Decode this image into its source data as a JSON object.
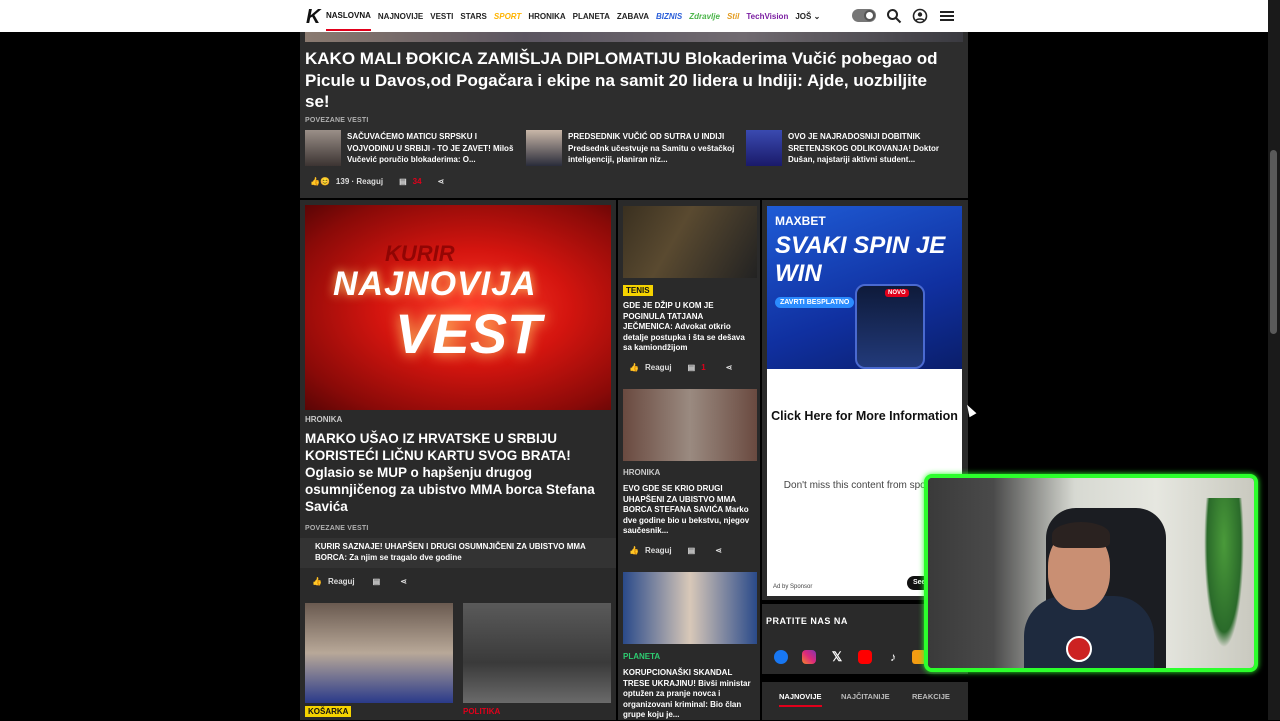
{
  "nav": {
    "logo": "K",
    "items": [
      "NASLOVNA",
      "NAJNOVIJE",
      "VESTI",
      "STARS",
      "SPORT",
      "HRONIKA",
      "PLANETA",
      "ZABAVA",
      "BIZNIS",
      "Zdravlje",
      "Stil",
      "TechVision",
      "JOŠ"
    ],
    "active": "NASLOVNA"
  },
  "top_story": {
    "headline": "KAKO MALI ĐOKICA ZAMIŠLJA DIPLOMATIJU Blokaderima Vučić pobegao od Picule u Davos,od Pogačara i ekipe na samit 20 lidera u Indiji: Ajde, uozbiljite se!",
    "related_label": "POVEZANE VESTI",
    "related": [
      {
        "text": "SAČUVAĆEMO MATICU SRPSKU I VOJVODINU U SRBIJI - TO JE ZAVET! Miloš Vučević poručio blokaderima: O..."
      },
      {
        "text": "PREDSEDNIK VUČIĆ OD SUTRA U INDIJI Predsednk učestvuje na Samitu o veštačkoj inteligenciji, planiran niz..."
      },
      {
        "text": "OVO JE NAJRADOSNIJI DOBITNIK SRETENJSKOG ODLIKOVANJA! Doktor Dušan, najstariji aktivni student..."
      }
    ],
    "reactions": "139 · Reaguj",
    "comments": "34"
  },
  "hero": {
    "img_text": [
      "KURIR",
      "NAJNOVIJA",
      "VEST"
    ],
    "category": "HRONIKA",
    "headline": "MARKO UŠAO IZ HRVATSKE U SRBIJU KORISTEĆI LIČNU KARTU SVOG BRATA! Oglasio se MUP o hapšenju drugog osumnjičenog za ubistvo MMA borca Stefana Savića",
    "related_label": "POVEZANE VESTI",
    "related": "KURIR SAZNAJE! UHAPŠEN I DRUGI OSUMNJIČENI ZA UBISTVO MMA BORCA: Za njim se tragalo dve godine",
    "react_label": "Reaguj"
  },
  "col2": [
    {
      "tag": "TENIS",
      "tag_color": "#f5d300",
      "text": "GDE JE DŽIP U KOM JE POGINULA TATJANA JEČMENICA: Advokat otkrio detalje postupka i šta se dešava sa kamiondžijom",
      "react": "Reaguj",
      "comments": "1"
    },
    {
      "tag": "HRONIKA",
      "text": "EVO GDE SE KRIO DRUGI UHAPŠENI ZA UBISTVO MMA BORCA STEFANA SAVIĆA Marko dve godine bio u bekstvu, njegov saučesnik...",
      "react": "Reaguj"
    },
    {
      "tag": "PLANETA",
      "tag_color": "#2ecc71",
      "text": "KORUPCIONAŠKI SKANDAL TRESE UKRAJINU! Bivši ministar optužen za pranje novca i organizovani kriminal: Bio član grupe koju je..."
    }
  ],
  "bottom_tags": [
    {
      "label": "KOŠARKA",
      "color": "#f5d300"
    },
    {
      "label": "POLITIKA",
      "color": "#e1001b"
    }
  ],
  "ad": {
    "brand": "MAXBET",
    "slogan": "SVAKI SPIN JE WIN",
    "cta": "ZAVRTI BESPLATNO",
    "badge": "NOVO",
    "click": "Click Here for More Information",
    "dont_miss": "Don't miss this content from sponsor",
    "by": "Ad by Sponsor",
    "button": "See"
  },
  "follow": {
    "title": "PRATITE NAS NA",
    "networks": [
      "facebook",
      "instagram",
      "x",
      "youtube",
      "tiktok",
      "rss"
    ]
  },
  "tabs": [
    "NAJNOVIJE",
    "NAJČITANIJE",
    "REAKCIJE"
  ]
}
